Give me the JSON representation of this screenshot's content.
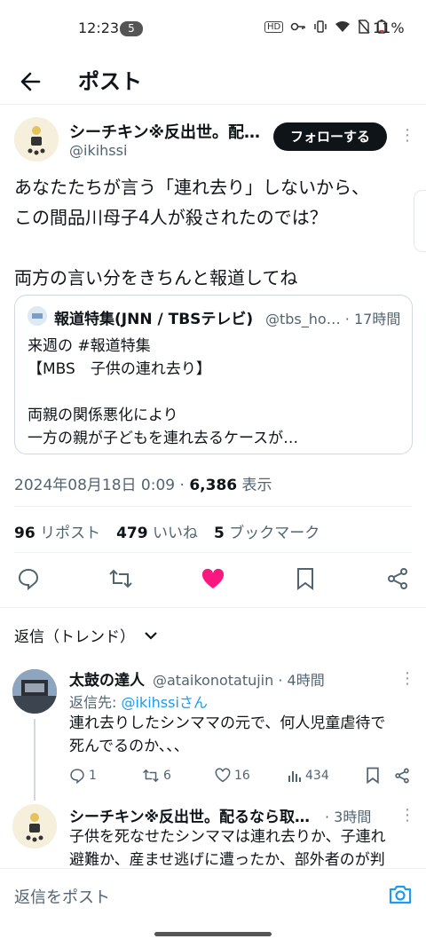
{
  "status": {
    "time": "12:23",
    "notif_count": "5",
    "battery": "11%",
    "hd_badge": "HD"
  },
  "topbar": {
    "title": "ポスト"
  },
  "post": {
    "author": "シーチキン※反出世。配…",
    "handle": "@ikihssi",
    "follow_label": "フォローする",
    "body_line1": "あなたたちが言う「連れ去り」しないから、",
    "body_line2": "この間品川母子4人が殺されたのでは？",
    "body_line3": "両方の言い分をきちんと報道してね",
    "timestamp": "2024年08月18日 0:09 · ",
    "views": "6,386",
    "views_label": " 表示"
  },
  "quote": {
    "name": "報道特集(JNN / TBSテレビ)",
    "handle": "@tbs_ho… · 17時間",
    "text": "来週の #報道特集\n【MBS　子供の連れ去り】\n\n両親の関係悪化により\n一方の親が子どもを連れ去るケースが…"
  },
  "stats": {
    "reposts": "96",
    "reposts_label": " リポスト",
    "likes": "479",
    "likes_label": " いいね",
    "bookmarks": "5",
    "bookmarks_label": " ブックマーク"
  },
  "replies_sort": {
    "label": "返信（トレンド）"
  },
  "replies": [
    {
      "name": "太鼓の達人",
      "meta": "@ataikonotatujin · 4時間",
      "reply_to_prefix": "返信先: ",
      "reply_to_handle": "@ikihssiさん",
      "text_line1": "連れ去りしたシンママの元で、何人児童虐待で",
      "text_line2": "死んでるのか、、、",
      "comments": "1",
      "retweets": "6",
      "likes": "16",
      "views": "434"
    },
    {
      "name": "シーチキン※反出世。配るなら取…",
      "meta": " · 3時間",
      "text_line1": "子供を死なせたシンママは連れ去りか、子連れ",
      "text_line2": "避難か、産ませ逃げに遭ったか、部外者のが判"
    }
  ],
  "composer": {
    "placeholder": "返信をポスト"
  },
  "colors": {
    "like_pink": "#f91880",
    "link_blue": "#1d9bf0",
    "text": "#0f1419",
    "muted": "#536471"
  }
}
